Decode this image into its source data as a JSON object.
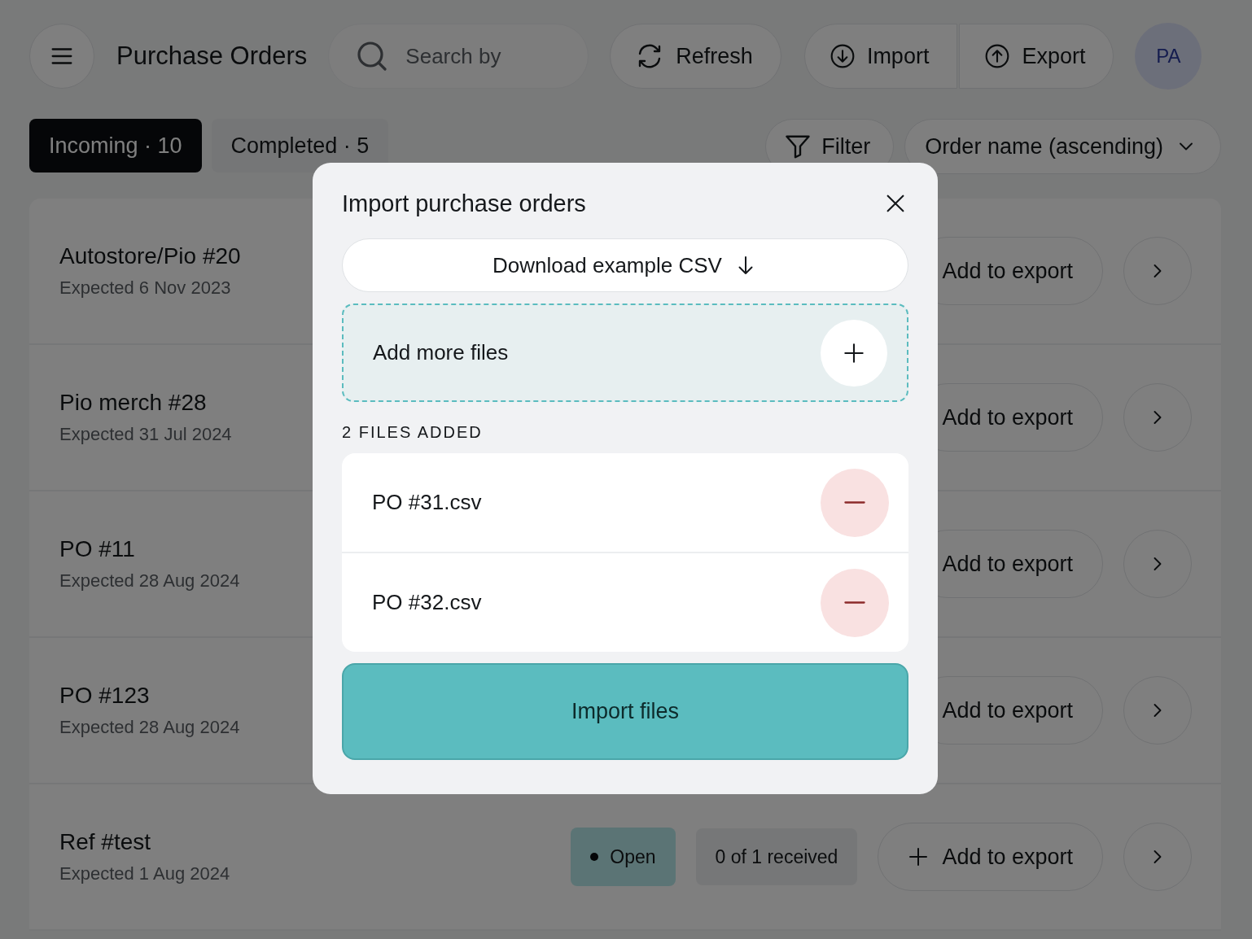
{
  "header": {
    "title": "Purchase Orders",
    "search": {
      "placeholder": "Search by"
    },
    "buttons": [
      {
        "kind": "refresh",
        "label": "Refresh"
      },
      {
        "kind": "import",
        "label": "Import"
      },
      {
        "kind": "export",
        "label": "Export"
      }
    ],
    "avatar": "PA"
  },
  "tabs": [
    {
      "label": "Incoming · 10",
      "selected": true
    },
    {
      "label": "Completed · 5",
      "selected": false
    }
  ],
  "filter": {
    "label": "Filter"
  },
  "sort": {
    "label": "Order name (ascending)"
  },
  "orders": [
    {
      "name": "Autostore/Pio #20",
      "expected": "Expected 6 Nov 2023",
      "action": "Add to export"
    },
    {
      "name": "Pio merch #28",
      "expected": "Expected 31 Jul 2024",
      "action": "Add to export"
    },
    {
      "name": "PO #11",
      "expected": "Expected 28 Aug 2024",
      "action": "Add to export"
    },
    {
      "name": "PO #123",
      "expected": "Expected 28 Aug 2024",
      "action": "Add to export"
    },
    {
      "name": "Ref #test",
      "expected": "Expected 1 Aug 2024",
      "status": "Open",
      "received": "0 of 1 received",
      "action": "Add to export"
    }
  ],
  "dialog": {
    "title": "Import purchase orders",
    "download": "Download example CSV",
    "dropzone": "Add more files",
    "files_heading": "2 FILES ADDED",
    "files": [
      "PO #31.csv",
      "PO #32.csv"
    ],
    "submit": "Import files"
  }
}
